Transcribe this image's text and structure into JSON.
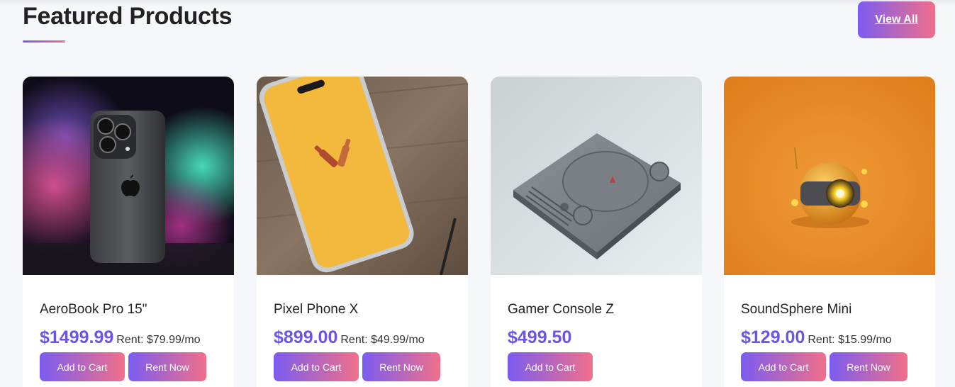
{
  "section": {
    "title": "Featured Products",
    "view_all_label": "View All"
  },
  "products": [
    {
      "name": "AeroBook Pro 15\"",
      "price": "$1499.99",
      "rent": "Rent: $79.99/mo",
      "add_to_cart_label": "Add to Cart",
      "rent_now_label": "Rent Now",
      "image": "smartphone-photo"
    },
    {
      "name": "Pixel Phone X",
      "price": "$899.00",
      "rent": "Rent: $49.99/mo",
      "add_to_cart_label": "Add to Cart",
      "rent_now_label": "Rent Now",
      "image": "yellow-phone-photo"
    },
    {
      "name": "Gamer Console Z",
      "price": "$499.50",
      "add_to_cart_label": "Add to Cart",
      "image": "game-console-photo"
    },
    {
      "name": "SoundSphere Mini",
      "price": "$129.00",
      "rent": "Rent: $15.99/mo",
      "add_to_cart_label": "Add to Cart",
      "rent_now_label": "Rent Now",
      "image": "speaker-drone-photo"
    }
  ],
  "colors": {
    "accent_start": "#7b5cf0",
    "accent_end": "#f0708a",
    "price": "#6a55e6",
    "background": "#f6f7fb"
  }
}
